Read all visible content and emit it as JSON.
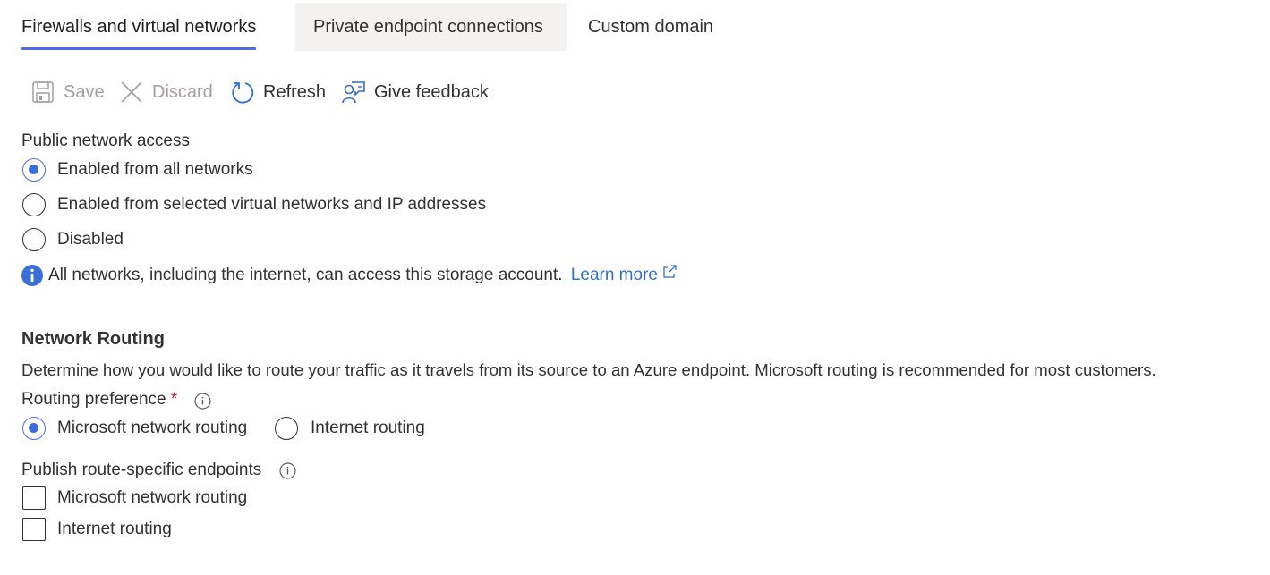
{
  "tabs": [
    {
      "label": "Firewalls and virtual networks",
      "active": true
    },
    {
      "label": "Private endpoint connections",
      "active": false
    },
    {
      "label": "Custom domain",
      "active": false
    }
  ],
  "toolbar": {
    "save_label": "Save",
    "discard_label": "Discard",
    "refresh_label": "Refresh",
    "feedback_label": "Give feedback"
  },
  "public_access": {
    "label": "Public network access",
    "options": [
      {
        "label": "Enabled from all networks",
        "selected": true
      },
      {
        "label": "Enabled from selected virtual networks and IP addresses",
        "selected": false
      },
      {
        "label": "Disabled",
        "selected": false
      }
    ],
    "info_text": "All networks, including the internet, can access this storage account.",
    "learn_more": "Learn more"
  },
  "routing": {
    "heading": "Network Routing",
    "description": "Determine how you would like to route your traffic as it travels from its source to an Azure endpoint. Microsoft routing is recommended for most customers.",
    "preference_label": "Routing preference",
    "required_mark": "*",
    "options": [
      {
        "label": "Microsoft network routing",
        "selected": true
      },
      {
        "label": "Internet routing",
        "selected": false
      }
    ],
    "publish_label": "Publish route-specific endpoints",
    "publish_options": [
      {
        "label": "Microsoft network routing",
        "checked": false
      },
      {
        "label": "Internet routing",
        "checked": false
      }
    ]
  },
  "colors": {
    "accent": "#4f6bed",
    "link": "#2f6fcf",
    "info_icon": "#3a6fd8",
    "required": "#a4262c"
  }
}
